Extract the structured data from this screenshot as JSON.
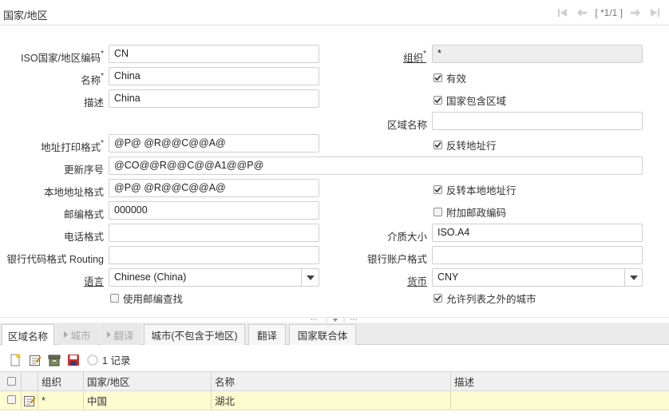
{
  "header": {
    "title": "国家/地区",
    "record_indicator": "[ *1/1 ]"
  },
  "form": {
    "iso_code": {
      "label": "ISO国家/地区编码",
      "value": "CN"
    },
    "organization": {
      "label": "组织",
      "value": "*"
    },
    "name": {
      "label": "名称",
      "value": "China"
    },
    "active": {
      "label": "有效",
      "checked": true
    },
    "description": {
      "label": "描述",
      "value": "China"
    },
    "has_region": {
      "label": "国家包含区域",
      "checked": true
    },
    "region_name": {
      "label": "区域名称",
      "value": ""
    },
    "address_print_format": {
      "label": "地址打印格式",
      "value": "@P@ @R@@C@@A@"
    },
    "reverse_address": {
      "label": "反转地址行",
      "checked": true
    },
    "update_sequence": {
      "label": "更新序号",
      "value": "@CO@@R@@C@@A1@@P@"
    },
    "local_address_format": {
      "label": "本地地址格式",
      "value": "@P@ @R@@C@@A@"
    },
    "reverse_local_address": {
      "label": "反转本地地址行",
      "checked": true
    },
    "postal_format": {
      "label": "邮编格式",
      "value": "000000"
    },
    "additional_postal": {
      "label": "附加邮政编码",
      "checked": false
    },
    "phone_format": {
      "label": "电话格式",
      "value": ""
    },
    "media_size": {
      "label": "介质大小",
      "value": "ISO.A4"
    },
    "bank_routing_format": {
      "label": "银行代码格式 Routing",
      "value": ""
    },
    "bank_account_format": {
      "label": "银行账户格式",
      "value": ""
    },
    "language": {
      "label": "语言",
      "value": "Chinese (China)"
    },
    "currency": {
      "label": "货币",
      "value": "CNY"
    },
    "use_postcode_lookup": {
      "label": "使用邮编查找",
      "checked": false
    },
    "allow_cities_outside_list": {
      "label": "允许列表之外的城市",
      "checked": true
    }
  },
  "tabs": [
    {
      "label": "区域名称",
      "state": "active"
    },
    {
      "label": "城市",
      "state": "disabled"
    },
    {
      "label": "翻译",
      "state": "disabled"
    },
    {
      "label": "城市(不包含于地区)",
      "state": "normal"
    },
    {
      "label": "翻译",
      "state": "normal"
    },
    {
      "label": "国家联合体",
      "state": "normal"
    }
  ],
  "grid": {
    "record_count": "1 记录",
    "columns": [
      "组织",
      "国家/地区",
      "名称",
      "描述"
    ],
    "rows": [
      {
        "org": "*",
        "country": "中国",
        "name": "湖北",
        "description": ""
      }
    ]
  },
  "colors": {
    "selected_row": "#fdfbd0",
    "readonly_field": "#eeeeee",
    "tabbar": "#ebebeb"
  }
}
